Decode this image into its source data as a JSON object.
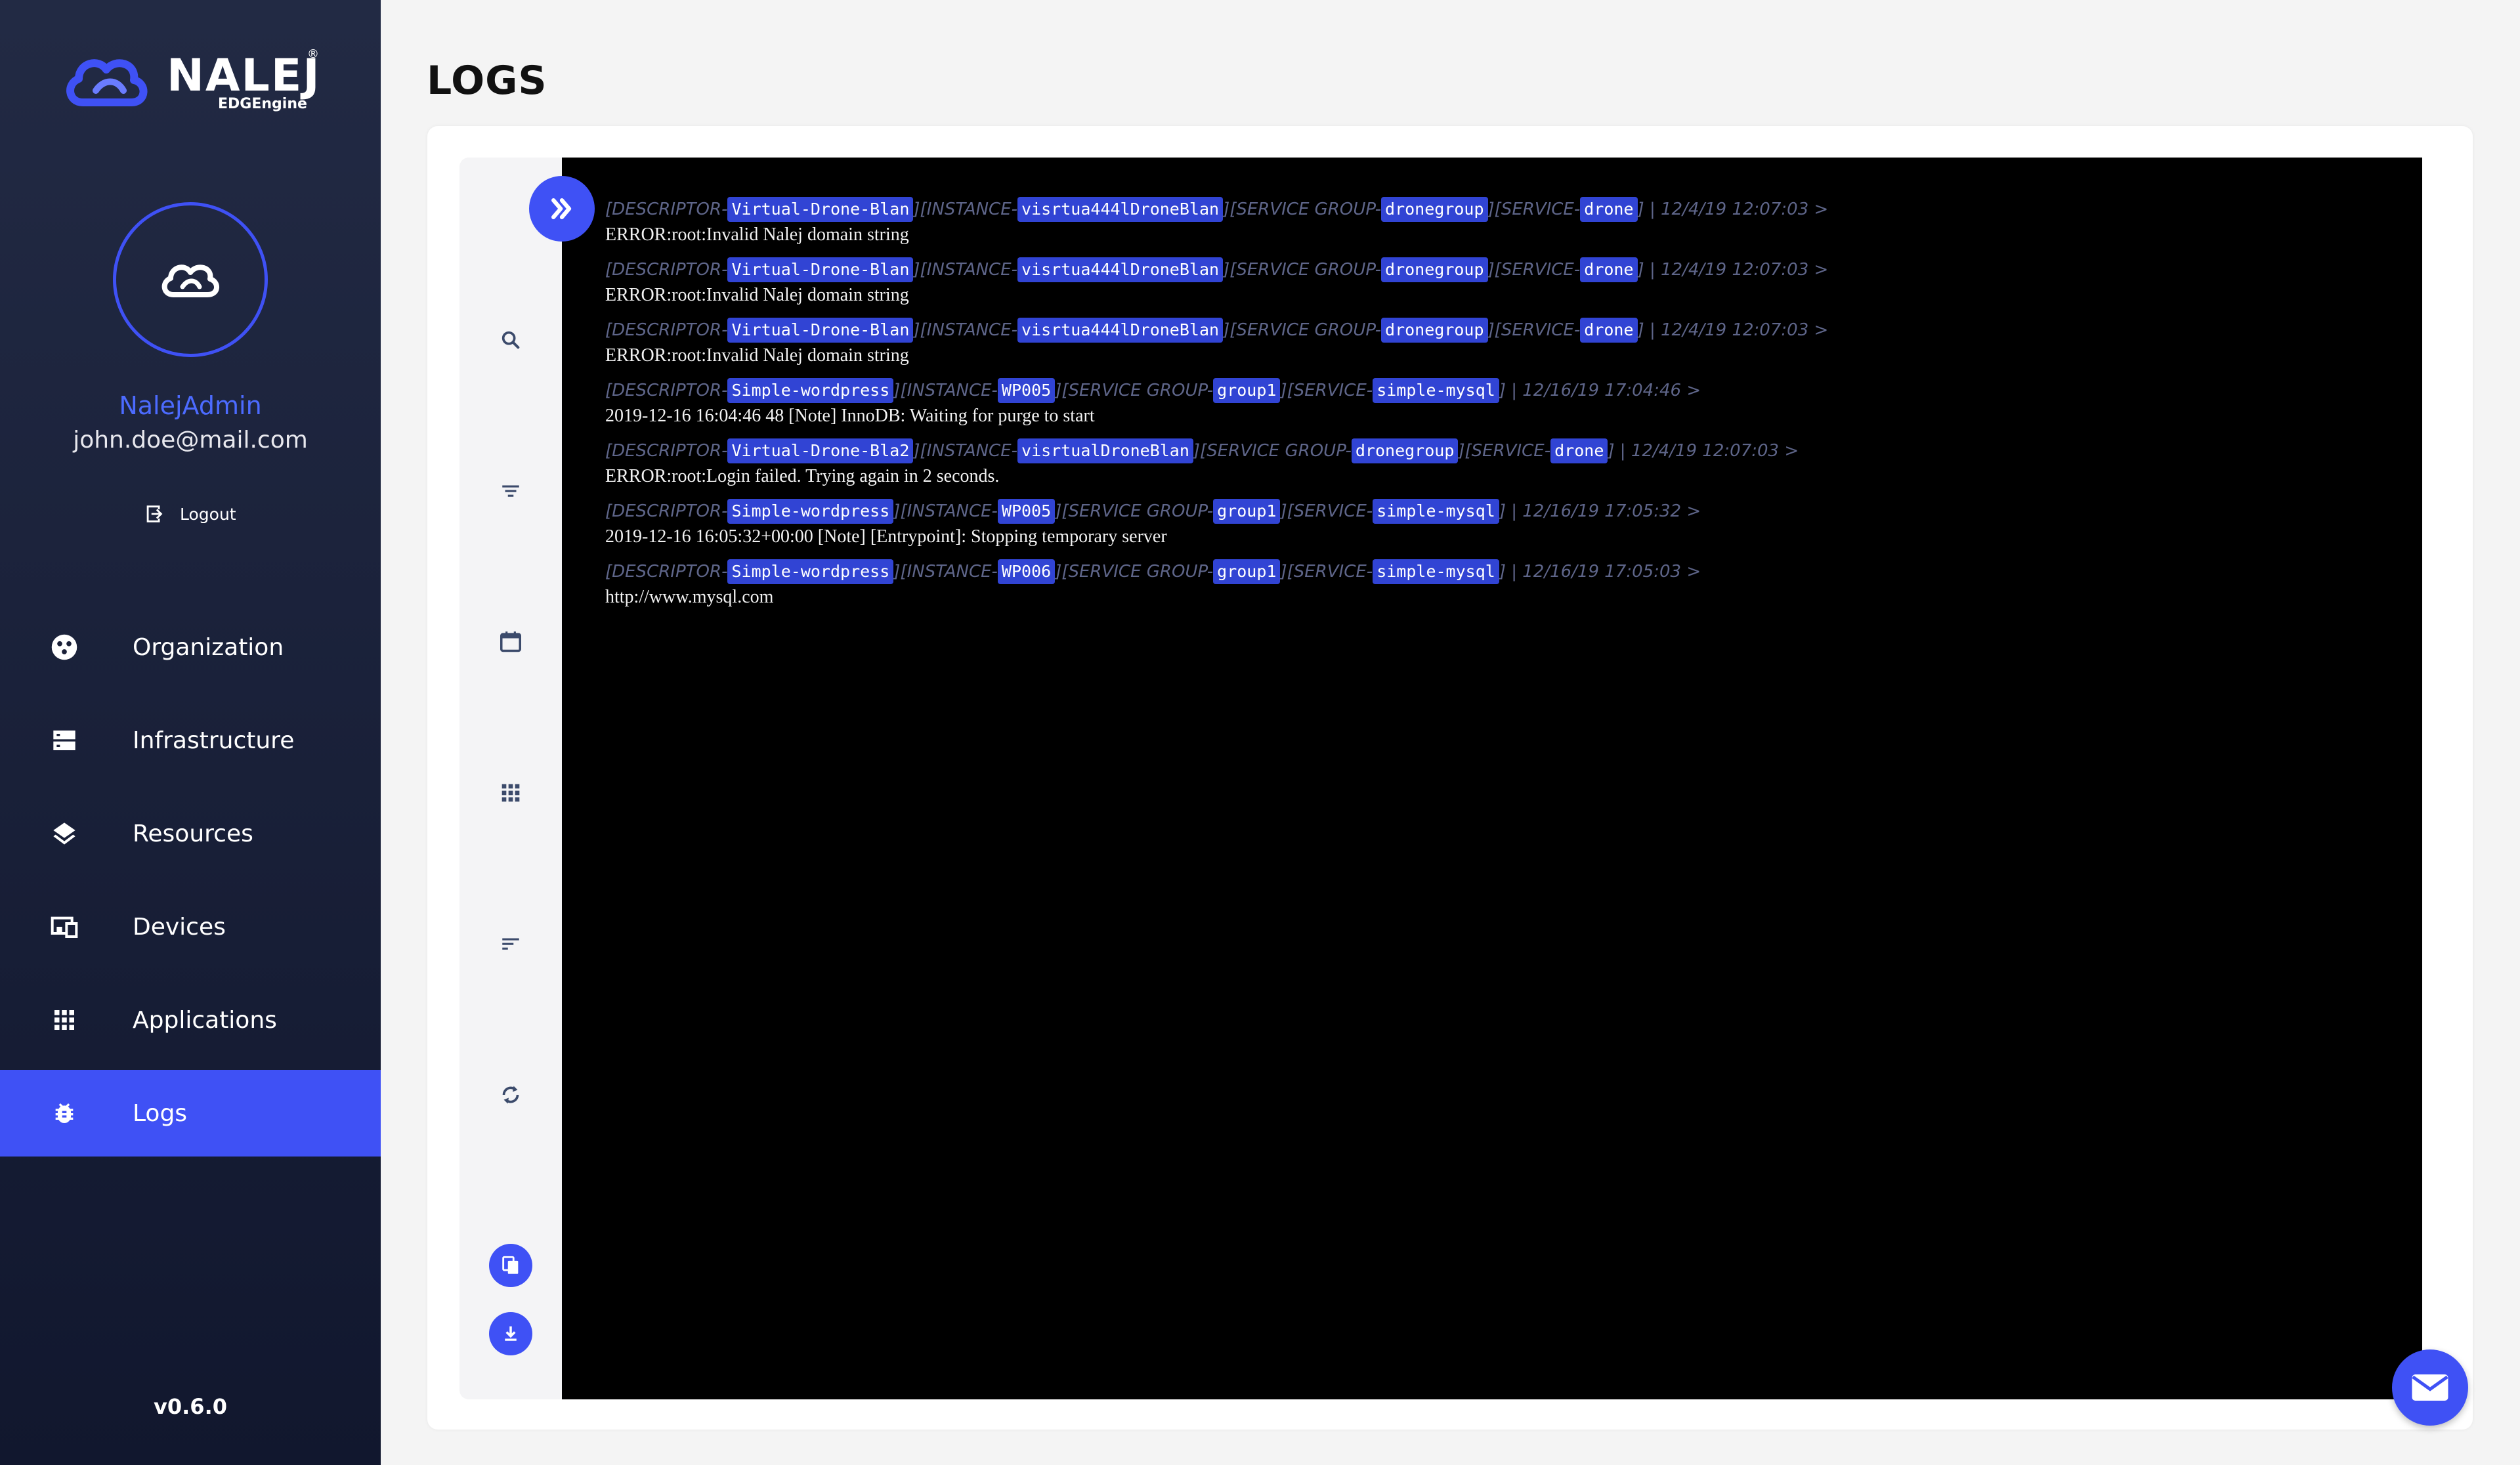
{
  "brand": {
    "name": "NALEJ",
    "subtitle": "EDGEngine",
    "reg": "®"
  },
  "user": {
    "name": "NalejAdmin",
    "email": "john.doe@mail.com",
    "logout_label": "Logout"
  },
  "nav": {
    "items": [
      {
        "label": "Organization",
        "icon": "organization-icon",
        "active": false
      },
      {
        "label": "Infrastructure",
        "icon": "server-icon",
        "active": false
      },
      {
        "label": "Resources",
        "icon": "layers-icon",
        "active": false
      },
      {
        "label": "Devices",
        "icon": "devices-icon",
        "active": false
      },
      {
        "label": "Applications",
        "icon": "apps-grid-icon",
        "active": false
      },
      {
        "label": "Logs",
        "icon": "bug-icon",
        "active": true
      }
    ]
  },
  "version": "v0.6.0",
  "page": {
    "title": "LOGS"
  },
  "toolbar": {
    "items": [
      "search-icon",
      "filter-icon",
      "calendar-icon",
      "grid-icon",
      "sort-icon",
      "refresh-icon",
      "copy-icon",
      "download-icon"
    ]
  },
  "colors": {
    "accent": "#3f51f5",
    "sidebar": "#1a2038",
    "chip": "#3144d4",
    "terminal": "#000000"
  },
  "logs": [
    {
      "descriptor": "Virtual-Drone-Blan",
      "instance": "visrtua444lDroneBlan",
      "service_group": "dronegroup",
      "service": "drone",
      "timestamp": "12/4/19 12:07:03 >",
      "message": "ERROR:root:Invalid Nalej domain string"
    },
    {
      "descriptor": "Virtual-Drone-Blan",
      "instance": "visrtua444lDroneBlan",
      "service_group": "dronegroup",
      "service": "drone",
      "timestamp": "12/4/19 12:07:03 >",
      "message": "ERROR:root:Invalid Nalej domain string"
    },
    {
      "descriptor": "Virtual-Drone-Blan",
      "instance": "visrtua444lDroneBlan",
      "service_group": "dronegroup",
      "service": "drone",
      "timestamp": "12/4/19 12:07:03 >",
      "message": "ERROR:root:Invalid Nalej domain string"
    },
    {
      "descriptor": "Simple-wordpress",
      "instance": "WP005",
      "service_group": "group1",
      "service": "simple-mysql",
      "timestamp": "12/16/19 17:04:46 >",
      "message": "2019-12-16 16:04:46 48 [Note] InnoDB: Waiting for purge to start"
    },
    {
      "descriptor": "Virtual-Drone-Bla2",
      "instance": "visrtualDroneBlan",
      "service_group": "dronegroup",
      "service": "drone",
      "timestamp": "12/4/19 12:07:03 >",
      "message": "ERROR:root:Login failed. Trying again in 2 seconds."
    },
    {
      "descriptor": "Simple-wordpress",
      "instance": "WP005",
      "service_group": "group1",
      "service": "simple-mysql",
      "timestamp": "12/16/19 17:05:32 >",
      "message": "2019-12-16 16:05:32+00:00 [Note] [Entrypoint]: Stopping temporary server"
    },
    {
      "descriptor": "Simple-wordpress",
      "instance": "WP006",
      "service_group": "group1",
      "service": "simple-mysql",
      "timestamp": "12/16/19 17:05:03 >",
      "message": "http://www.mysql.com"
    }
  ],
  "labels": {
    "descriptor": "[DESCRIPTOR",
    "instance": "INSTANCE",
    "service_group": "SERVICE GROUP",
    "service": "SERVICE"
  }
}
